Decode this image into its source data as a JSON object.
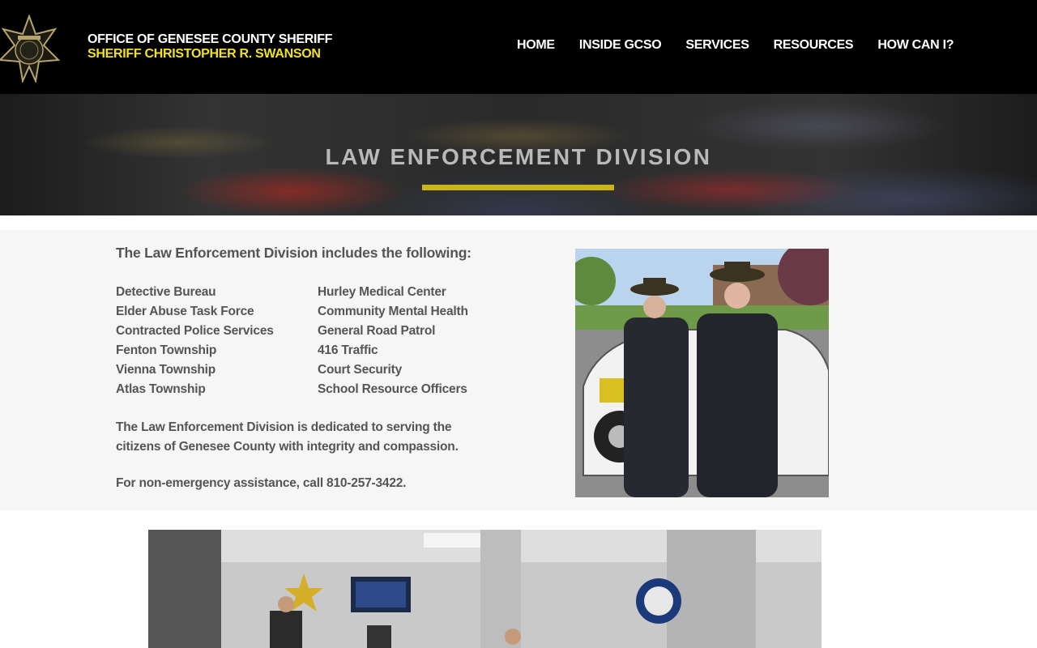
{
  "header": {
    "org_line1": "OFFICE OF GENESEE COUNTY SHERIFF",
    "org_line2": "SHERIFF CHRISTOPHER R. SWANSON",
    "nav": [
      "HOME",
      "INSIDE GCSO",
      "SERVICES",
      "RESOURCES",
      "HOW CAN I?"
    ]
  },
  "banner": {
    "title": "LAW ENFORCEMENT DIVISION",
    "rule_color": "#c9b518"
  },
  "content": {
    "intro": "The Law Enforcement Division includes the following:",
    "col_left": [
      "Detective Bureau",
      "Elder Abuse Task Force",
      "Contracted Police Services",
      "Fenton Township",
      "Vienna Township",
      "Atlas Township"
    ],
    "col_right": [
      "Hurley Medical Center",
      "Community Mental Health",
      "General Road Patrol",
      "416 Traffic",
      "Court Security",
      "School Resource Officers"
    ],
    "description_line1": "The Law Enforcement Division is dedicated to serving the",
    "description_line2": "citizens of Genesee County with integrity and compassion.",
    "phone_note": "For non-emergency assistance, call 810-257-3422."
  },
  "colors": {
    "header_bg": "#000000",
    "accent_yellow": "#f2e21e",
    "info_bg": "#f6f6f6"
  }
}
